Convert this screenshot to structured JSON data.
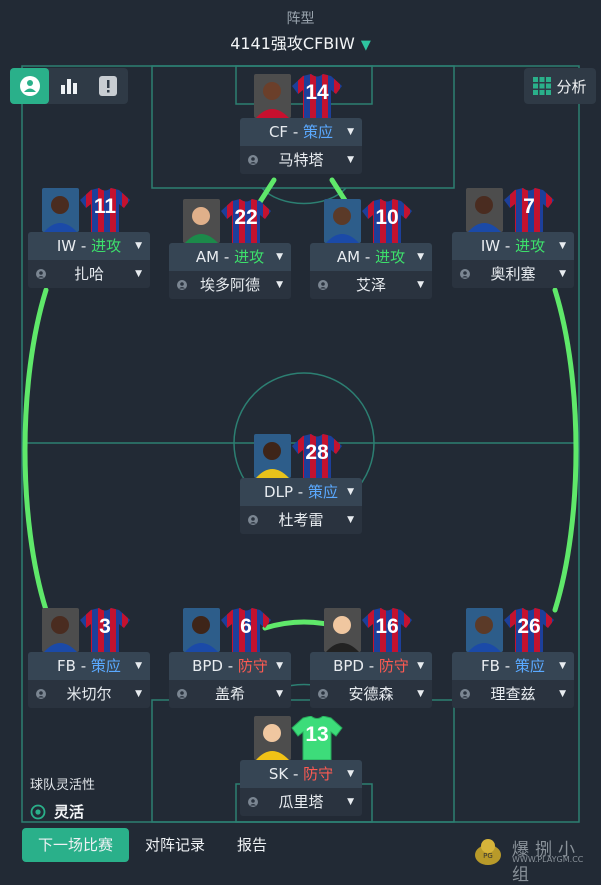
{
  "header": {
    "label": "阵型",
    "formation": "4141强攻CFBIW"
  },
  "analyze_label": "分析",
  "colors": {
    "accent": "#2ab08a",
    "pitch_line": "#2c7f72",
    "link": "#5fe86a",
    "attack": "#3de06b",
    "support": "#5aa9ff",
    "defend": "#ff5a52"
  },
  "players": [
    {
      "number": "14",
      "role": "CF",
      "duty": "策应",
      "duty_type": "support",
      "name": "马特塔",
      "kit": "outfield"
    },
    {
      "number": "11",
      "role": "IW",
      "duty": "进攻",
      "duty_type": "attack",
      "name": "扎哈",
      "kit": "outfield"
    },
    {
      "number": "22",
      "role": "AM",
      "duty": "进攻",
      "duty_type": "attack",
      "name": "埃多阿德",
      "kit": "outfield"
    },
    {
      "number": "10",
      "role": "AM",
      "duty": "进攻",
      "duty_type": "attack",
      "name": "艾泽",
      "kit": "outfield"
    },
    {
      "number": "7",
      "role": "IW",
      "duty": "进攻",
      "duty_type": "attack",
      "name": "奥利塞",
      "kit": "outfield"
    },
    {
      "number": "28",
      "role": "DLP",
      "duty": "策应",
      "duty_type": "support",
      "name": "杜考雷",
      "kit": "outfield"
    },
    {
      "number": "3",
      "role": "FB",
      "duty": "策应",
      "duty_type": "support",
      "name": "米切尔",
      "kit": "outfield"
    },
    {
      "number": "6",
      "role": "BPD",
      "duty": "防守",
      "duty_type": "defend",
      "name": "盖希",
      "kit": "outfield"
    },
    {
      "number": "16",
      "role": "BPD",
      "duty": "防守",
      "duty_type": "defend",
      "name": "安德森",
      "kit": "outfield"
    },
    {
      "number": "26",
      "role": "FB",
      "duty": "策应",
      "duty_type": "support",
      "name": "理查兹",
      "kit": "outfield"
    },
    {
      "number": "13",
      "role": "SK",
      "duty": "防守",
      "duty_type": "defend",
      "name": "瓜里塔",
      "kit": "keeper"
    }
  ],
  "flexibility": {
    "title": "球队灵活性",
    "value": "灵活"
  },
  "tabs": [
    "下一场比赛",
    "对阵记录",
    "报告"
  ],
  "watermark": {
    "text": "爆捌小组",
    "url": "WWW.PLAYGM.CC"
  }
}
